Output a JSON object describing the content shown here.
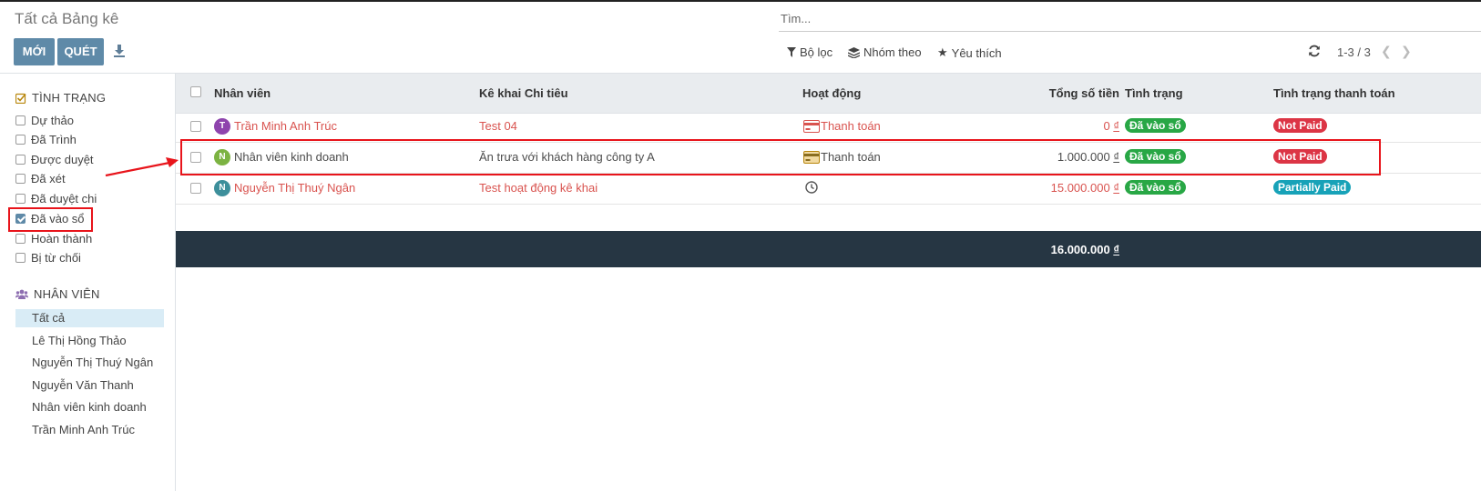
{
  "page": {
    "title": "Tất cả Bảng kê"
  },
  "toolbar": {
    "new_label": "MỚI",
    "scan_label": "QUÉT",
    "download_icon": "download-icon"
  },
  "search": {
    "placeholder": "Tìm..."
  },
  "filters": {
    "filter_label": "Bộ lọc",
    "group_label": "Nhóm theo",
    "fav_label": "Yêu thích"
  },
  "pager": {
    "value": "1-3 / 3"
  },
  "sidebar": {
    "status_title": "TÌNH TRẠNG",
    "status_items": [
      {
        "label": "Dự thảo",
        "checked": false
      },
      {
        "label": "Đã Trình",
        "checked": false
      },
      {
        "label": "Được duyệt",
        "checked": false
      },
      {
        "label": "Đã xét",
        "checked": false
      },
      {
        "label": "Đã duyệt chi",
        "checked": false
      },
      {
        "label": "Đã vào sổ",
        "checked": true
      },
      {
        "label": "Hoàn thành",
        "checked": false
      },
      {
        "label": "Bị từ chối",
        "checked": false
      }
    ],
    "employee_title": "NHÂN VIÊN",
    "employee_items": [
      {
        "label": "Tất cả",
        "active": true
      },
      {
        "label": "Lê Thị Hồng Thảo",
        "active": false
      },
      {
        "label": "Nguyễn Thị Thuý Ngân",
        "active": false
      },
      {
        "label": "Nguyễn Văn Thanh",
        "active": false
      },
      {
        "label": "Nhân viên kinh doanh",
        "active": false
      },
      {
        "label": "Trần Minh Anh Trúc",
        "active": false
      }
    ]
  },
  "table": {
    "columns": [
      "Nhân viên",
      "Kê khai Chi tiêu",
      "Hoạt động",
      "Tổng số tiền",
      "Tình trạng",
      "Tình trạng thanh toán"
    ],
    "rows": [
      {
        "initial": "T",
        "avatar_color": "#8e44ad",
        "employee": "Trần Minh Anh Trúc",
        "expense": "Test 04",
        "activity": "Thanh toán",
        "activity_icon": "credit-card-icon",
        "amount": "0",
        "currency": "₫",
        "status": "Đã vào sổ",
        "payment": "Not Paid",
        "tone": "red"
      },
      {
        "initial": "N",
        "avatar_color": "#7cb342",
        "employee": "Nhân viên kinh doanh",
        "expense": "Ăn trưa với khách hàng công ty A",
        "activity": "Thanh toán",
        "activity_icon": "credit-card-icon",
        "amount": "1.000.000",
        "currency": "₫",
        "status": "Đã vào sổ",
        "payment": "Not Paid",
        "tone": "dark"
      },
      {
        "initial": "N",
        "avatar_color": "#3d8f9b",
        "employee": "Nguyễn Thị Thuý Ngân",
        "expense": "Test hoạt động kê khai",
        "activity": "",
        "activity_icon": "clock-icon",
        "amount": "15.000.000",
        "currency": "₫",
        "status": "Đã vào sổ",
        "payment": "Partially Paid",
        "tone": "red"
      }
    ],
    "total": "16.000.000",
    "total_currency": "₫"
  },
  "colors": {
    "primary": "#5f8aa8",
    "badge_green": "#28a745",
    "badge_red": "#dc3545",
    "badge_teal": "#17a2b8",
    "footer": "#263643",
    "annotation": "#e8141b"
  }
}
